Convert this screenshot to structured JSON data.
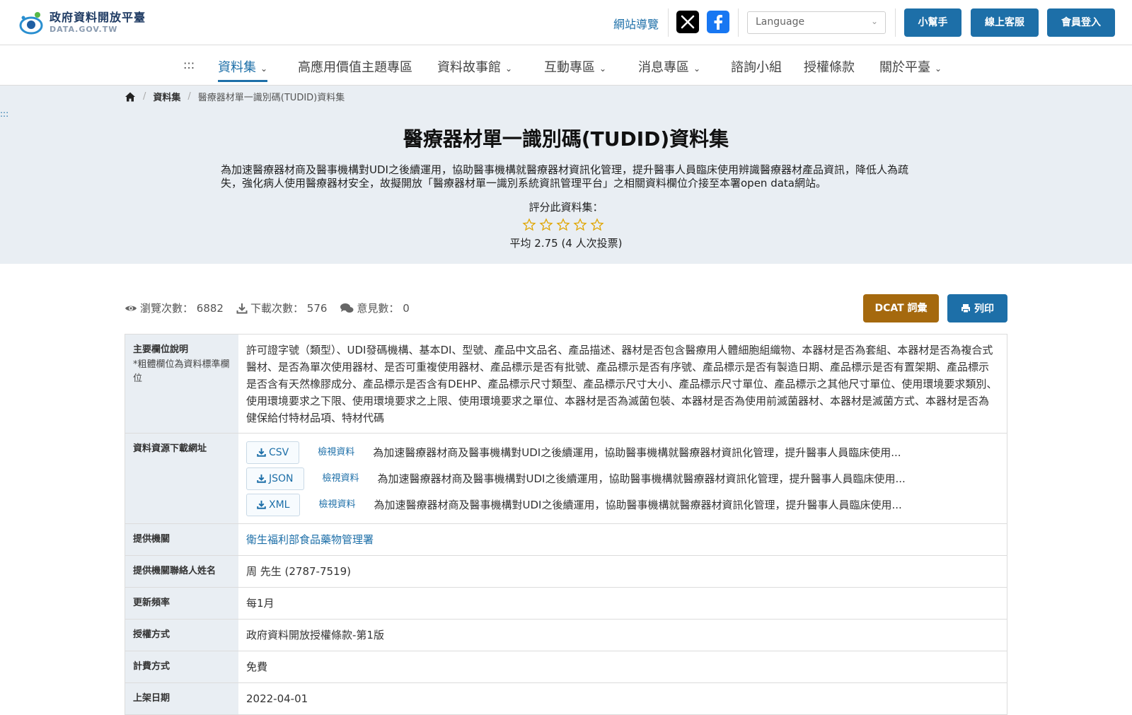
{
  "header": {
    "logo_title": "政府資料開放平臺",
    "logo_sub": "DATA.GOV.TW",
    "site_guide": "網站導覽",
    "language_placeholder": "Language",
    "buttons": {
      "helper": "小幫手",
      "support": "線上客服",
      "login": "會員登入"
    },
    "colors": {
      "primary": "#1d6fa8",
      "accent": "#a5690e"
    }
  },
  "nav": {
    "accesskey": ":::",
    "items": [
      {
        "label": "資料集",
        "dropdown": true,
        "active": true
      },
      {
        "label": "高應用價值主題專區",
        "dropdown": false
      },
      {
        "label": "資料故事館",
        "dropdown": true
      },
      {
        "label": "互動專區",
        "dropdown": true
      },
      {
        "label": "消息專區",
        "dropdown": true
      },
      {
        "label": "諮詢小組",
        "dropdown": false
      },
      {
        "label": "授權條款",
        "dropdown": false
      },
      {
        "label": "關於平臺",
        "dropdown": true
      }
    ]
  },
  "breadcrumb": {
    "items": [
      "資料集",
      "醫療器材單一識別碼(TUDID)資料集"
    ]
  },
  "accesskey_content": ":::",
  "dataset": {
    "title": "醫療器材單一識別碼(TUDID)資料集",
    "description": "為加速醫療器材商及醫事機構對UDI之後續運用，協助醫事機構就醫療器材資訊化管理，提升醫事人員臨床使用辨識醫療器材產品資訊，降低人為疏失，強化病人使用醫療器材安全，故擬開放「醫療器材單一識別系統資訊管理平台」之相關資料欄位介接至本署open data網站。",
    "rate_label": "評分此資料集：",
    "rating": {
      "average": 2.75,
      "votes": 4,
      "max": 5
    },
    "rating_text": "平均 2.75 (4 人次投票)"
  },
  "stats": {
    "views_label": "瀏覽次數：",
    "views": "6882",
    "downloads_label": "下載次數：",
    "downloads": "576",
    "comments_label": "意見數：",
    "comments": "0"
  },
  "actions": {
    "dcat": "DCAT 詞彙",
    "print": "列印"
  },
  "details": {
    "fields_label": "主要欄位說明",
    "fields_note": "*粗體欄位為資料標準欄位",
    "fields_value": "許可證字號（類型）、UDI發碼機構、基本DI、型號、產品中文品名、產品描述、器材是否包含醫療用人體細胞組織物、本器材是否為套組、本器材是否為複合式醫材、是否為單次使用器材、是否可重複使用器材、產品標示是否有批號、產品標示是否有序號、產品標示是否有製造日期、產品標示是否有置架期、產品標示是否含有天然橡膠成分、產品標示是否含有DEHP、產品標示尺寸類型、產品標示尺寸大小、產品標示尺寸單位、產品標示之其他尺寸單位、使用環境要求類別、使用環境要求之下限、使用環境要求之上限、使用環境要求之單位、本器材是否為滅菌包裝、本器材是否為使用前滅菌器材、本器材是滅菌方式、本器材是否為健保給付特材品項、特材代碼",
    "resources_label": "資料資源下載網址",
    "resources": [
      {
        "format": "CSV",
        "view": "檢視資料",
        "desc": "為加速醫療器材商及醫事機構對UDI之後續運用，協助醫事機構就醫療器材資訊化管理，提升醫事人員臨床使用..."
      },
      {
        "format": "JSON",
        "view": "檢視資料",
        "desc": "為加速醫療器材商及醫事機構對UDI之後續運用，協助醫事機構就醫療器材資訊化管理，提升醫事人員臨床使用..."
      },
      {
        "format": "XML",
        "view": "檢視資料",
        "desc": "為加速醫療器材商及醫事機構對UDI之後續運用，協助醫事機構就醫療器材資訊化管理，提升醫事人員臨床使用..."
      }
    ],
    "provider_label": "提供機關",
    "provider": "衛生福利部食品藥物管理署",
    "contact_label": "提供機關聯絡人姓名",
    "contact": "周 先生 (2787-7519)",
    "frequency_label": "更新頻率",
    "frequency": "每1月",
    "license_label": "授權方式",
    "license": "政府資料開放授權條款-第1版",
    "fee_label": "計費方式",
    "fee": "免費",
    "published_label": "上架日期",
    "published": "2022-04-01"
  }
}
